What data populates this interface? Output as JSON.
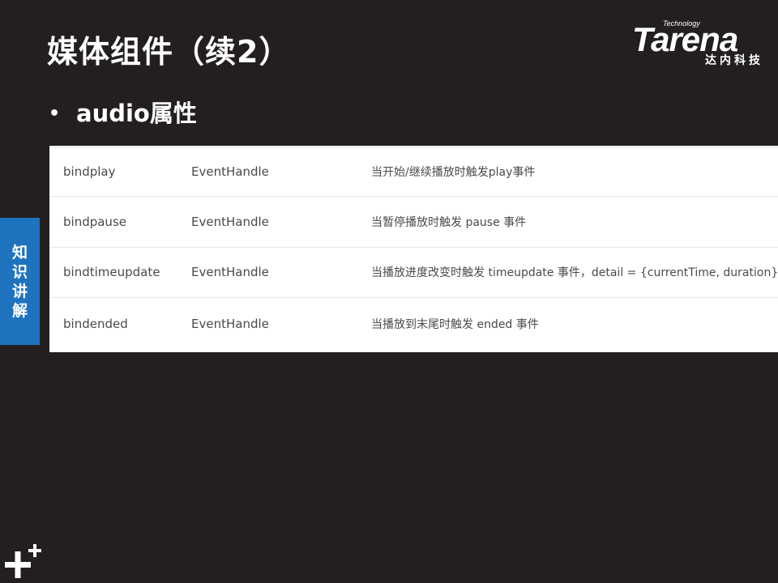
{
  "slide": {
    "title": "媒体组件（续2）",
    "bullet": "audio属性",
    "side_tab": "知识讲解"
  },
  "logo": {
    "tagline": "Technology",
    "wordmark": "Tarena",
    "chinese": "达内科技"
  },
  "table": {
    "rows": [
      {
        "name": "bindplay",
        "type": "EventHandle",
        "description": "当开始/继续播放时触发play事件"
      },
      {
        "name": "bindpause",
        "type": "EventHandle",
        "description": "当暂停播放时触发 pause 事件"
      },
      {
        "name": "bindtimeupdate",
        "type": "EventHandle",
        "description": "当播放进度改变时触发 timeupdate 事件，detail = {currentTime, duration}"
      },
      {
        "name": "bindended",
        "type": "EventHandle",
        "description": "当播放到末尾时触发 ended 事件"
      }
    ]
  },
  "colors": {
    "background": "#231f20",
    "side_tab": "#1e73be",
    "table_bg": "#ffffff",
    "text_dark": "#4a4a4a"
  },
  "icons": {
    "bullet": "bullet-dot-icon",
    "footer": "plus-mark-icon"
  }
}
